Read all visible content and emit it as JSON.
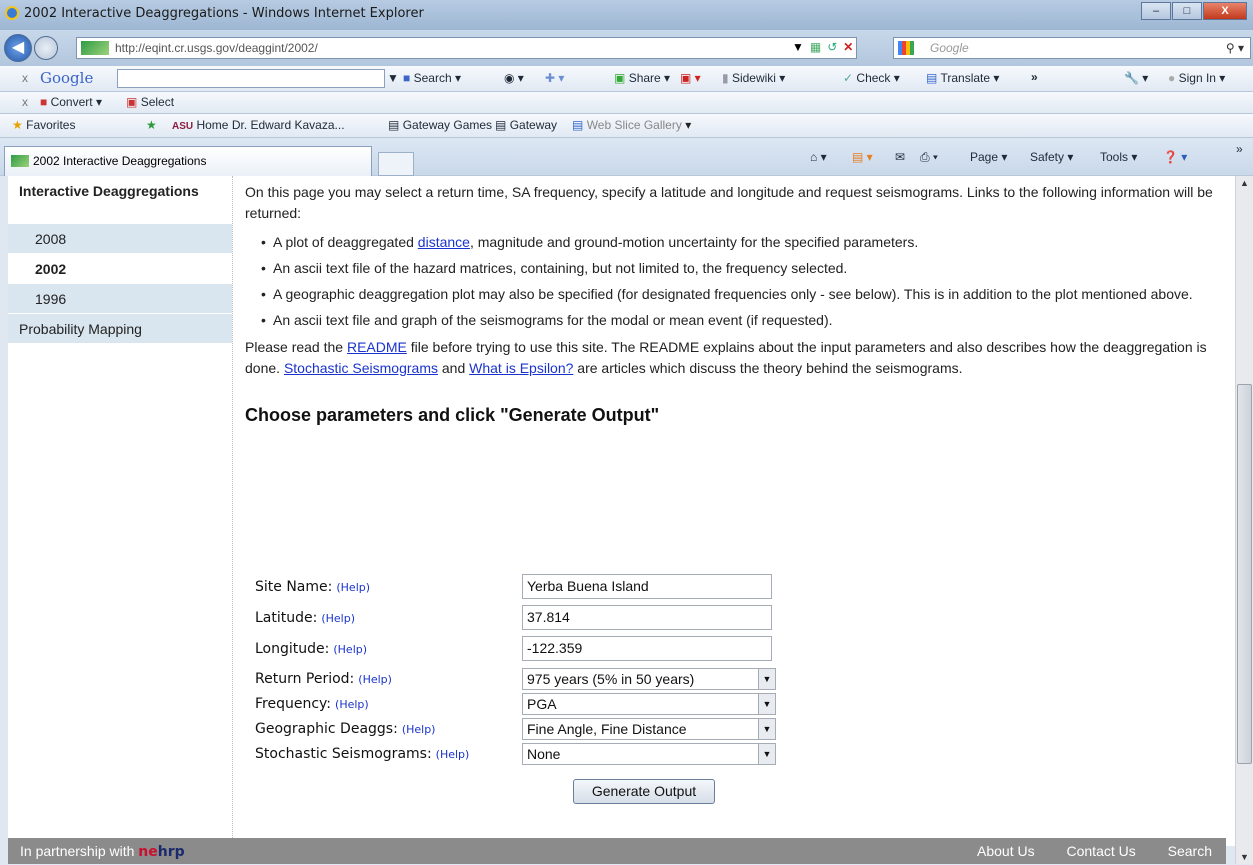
{
  "window": {
    "title": "2002 Interactive Deaggregations - Windows Internet Explorer",
    "min": "–",
    "max": "□",
    "close": "X"
  },
  "address": {
    "url": "http://eqint.cr.usgs.gov/deaggint/2002/",
    "search_placeholder": "Google"
  },
  "google_toolbar": {
    "brand": "Google",
    "search": "Search",
    "share": "Share",
    "sidewiki": "Sidewiki",
    "check": "Check",
    "translate": "Translate",
    "more": "»",
    "sign_in": "Sign In"
  },
  "convert_toolbar": {
    "convert": "Convert",
    "select": "Select"
  },
  "favorites_bar": {
    "favorites": "Favorites",
    "items": [
      "Home Dr. Edward Kavaza...",
      "Gateway Games",
      "Gateway",
      "Web Slice Gallery"
    ]
  },
  "tab": {
    "label": "2002 Interactive Deaggregations"
  },
  "command_bar": {
    "page": "Page",
    "safety": "Safety",
    "tools": "Tools"
  },
  "sidebar": {
    "heading": "Interactive Deaggregations",
    "items": [
      "2008",
      "2002",
      "1996"
    ],
    "probability": "Probability Mapping"
  },
  "intro": {
    "p1": "On this page you may select a return time, SA frequency, specify a latitude and longitude and request seismograms. Links to the following information will be returned:",
    "b1_pre": "A plot of deaggregated ",
    "b1_link": "distance",
    "b1_post": ", magnitude and ground-motion uncertainty for the specified parameters.",
    "b2": "An ascii text file of the hazard matrices, containing, but not limited to, the frequency selected.",
    "b3": "A geographic deaggregation plot may also be specified (for designated frequencies only - see below). This is in addition to the plot mentioned above.",
    "b4": "An ascii text file and graph of the seismograms for the modal or mean event (if requested).",
    "p2_a": "Please read the ",
    "p2_readme": "README",
    "p2_b": " file before trying to use this site. The README explains about the input parameters and also describes how the deaggregation is done. ",
    "p2_stoch": "Stochastic Seismograms",
    "p2_c": " and ",
    "p2_eps": "What is Epsilon?",
    "p2_d": " are articles which discuss the theory behind the seismograms."
  },
  "form": {
    "heading": "Choose parameters and click \"Generate Output\"",
    "help": "(Help)",
    "site_name_label": "Site Name:",
    "site_name_value": "Yerba Buena Island",
    "latitude_label": "Latitude:",
    "latitude_value": "37.814",
    "longitude_label": "Longitude:",
    "longitude_value": "-122.359",
    "return_period_label": "Return Period:",
    "return_period_value": "975 years (5% in 50 years)",
    "frequency_label": "Frequency:",
    "frequency_value": "PGA",
    "geo_label": "Geographic Deaggs:",
    "geo_value": "Fine Angle, Fine Distance",
    "stoch_label": "Stochastic Seismograms:",
    "stoch_value": "None",
    "generate": "Generate Output"
  },
  "footer": {
    "partnership": "In partnership with ",
    "nehrp_ne": "ne",
    "nehrp_hrp": "hrp",
    "about": "About Us",
    "contact": "Contact Us",
    "search": "Search"
  }
}
